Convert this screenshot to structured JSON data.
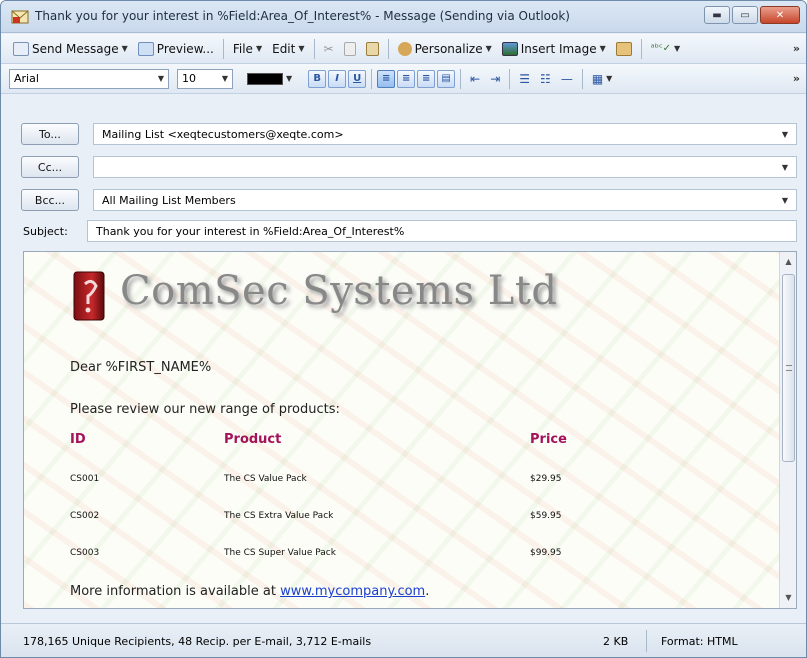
{
  "window": {
    "title": "Thank you for your interest in %Field:Area_Of_Interest% - Message (Sending via Outlook)",
    "controls": [
      "minimize",
      "maximize",
      "close"
    ]
  },
  "toolbar1": {
    "send_message": "Send Message",
    "preview": "Preview...",
    "file": "File",
    "edit": "Edit",
    "personalize": "Personalize",
    "insert_image": "Insert Image",
    "more": "»"
  },
  "toolbar2": {
    "font_family": "Arial",
    "font_size": "10",
    "font_color": "#000000",
    "bold": "B",
    "italic": "I",
    "underline": "U",
    "more": "»"
  },
  "header": {
    "to_label": "To...",
    "to_value": "Mailing List <xeqtecustomers@xeqte.com>",
    "cc_label": "Cc...",
    "cc_value": "",
    "bcc_label": "Bcc...",
    "bcc_value": "All Mailing List Members",
    "subject_label": "Subject:",
    "subject_value": "Thank you for your interest in %Field:Area_Of_Interest%"
  },
  "message": {
    "company_name": "ComSec Systems Ltd",
    "greeting": "Dear %FIRST_NAME%",
    "intro": "Please review our new range of products:",
    "columns": [
      "ID",
      "Product",
      "Price"
    ],
    "products": [
      {
        "id": "CS001",
        "name": "The CS Value Pack",
        "price": "$29.95"
      },
      {
        "id": "CS002",
        "name": "The CS Extra Value Pack",
        "price": "$59.95"
      },
      {
        "id": "CS003",
        "name": "The CS Super Value Pack",
        "price": "$99.95"
      }
    ],
    "more_info_text": "More information is available at",
    "more_info_link": "www.mycompany.com",
    "more_info_end": "."
  },
  "status": {
    "recipients": "178,165 Unique Recipients,  48 Recip. per E-mail,  3,712 E-mails",
    "size": "2 KB",
    "format": "Format: HTML"
  },
  "colors": {
    "table_header": "#a4125a",
    "link": "#1a3fcc"
  }
}
